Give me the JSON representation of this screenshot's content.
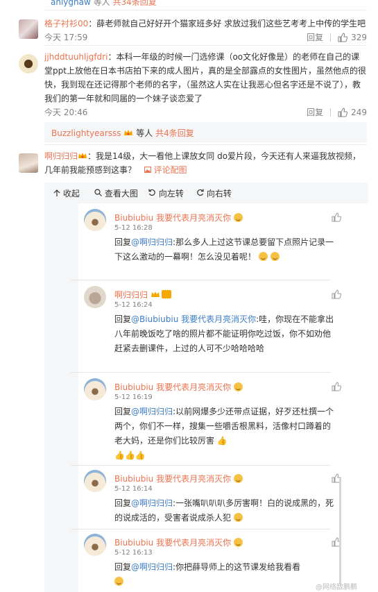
{
  "top_reply": {
    "user": "anlyghaw",
    "text_prefix": "等人",
    "count_link": "共34条回复"
  },
  "comments": [
    {
      "user": "格子衬衫00",
      "text": "：薛老师就自己好好开个猫家班多好 求放过我们这些艺考考上中传的学生吧",
      "time": "今天 17:59",
      "reply_label": "回复",
      "likes": "329"
    },
    {
      "user": "jjhddtuuhljgfdri",
      "text": "：本科一年级的时候一门选修课（oo文化好像是）的老师在自己的课堂ppt上放他在日本书店拍下来的成人图片，真的是全部露点的女性图片，虽然他点的很快，我到现在还记得那个老师的名字，（虽然这人实在让我恶心但名字还是不说了），教我们的第一年就和同届的一个妹子谈恋爱了",
      "time": "今天 20:46",
      "reply_label": "回复",
      "likes": "249"
    }
  ],
  "sub_summary": {
    "user": "Buzzlightyearsss",
    "text_mid": "等人",
    "count_link": "共4条回复"
  },
  "third_comment": {
    "user": "啊归归归",
    "text": "：我是14级，大一看他上课放女同 do爱片段，今天还有人来逼我放视频，几年前我能预感到这事？",
    "image_link": "评论配图"
  },
  "toolbar": {
    "collapse": "收起",
    "large_image": "查看大图",
    "rotate_left": "向左转",
    "rotate_right": "向右转"
  },
  "replies": [
    {
      "name": "Biubiubiu 我要代表月亮消灭你",
      "date": "5-12 16:28",
      "prefix": "回复",
      "target": "@啊归归归",
      "text": ":那么多人上过这节课总要留下点照片记录一下这么激动的一幕啊！怎么没见着呢！"
    },
    {
      "name": "啊归归归",
      "date": "5-12 16:24",
      "prefix": "回复",
      "target": "@Biubiubiu 我要代表月亮消灭你",
      "text": ":哇，你现在不能拿出八年前晚饭吃了啥的照片都不能证明你吃过饭，你不如劝他赶紧去删课件，上过的人可不少哈哈哈哈"
    },
    {
      "name": "Biubiubiu 我要代表月亮消灭你",
      "date": "5-12 16:19",
      "prefix": "回复",
      "target": "@啊归归归",
      "text": ":以前网爆多少还带点证据，好歹还杜撰一个两个，你们不一样，搜集一些嚼舌根黑料，活像村口蹲着的老大妈，还是你们比较厉害"
    },
    {
      "name": "Biubiubiu 我要代表月亮消灭你",
      "date": "5-12 16:14",
      "prefix": "回复",
      "target": "@啊归归归",
      "text": ":一张嘴叭叭叭多厉害啊！白的说成黑的，死的说成活的，受害者说成杀人犯"
    },
    {
      "name": "Biubiubiu 我要代表月亮消灭你",
      "date": "5-12 16:13",
      "prefix": "回复",
      "target": "@啊归归归",
      "text": ":你把薛导师上的这节课发给我看看"
    }
  ],
  "watermark": "@网络敌鹏鹏",
  "colors": {
    "accent": "#eb7350",
    "link": "#3b7dc6",
    "muted": "#808080"
  }
}
